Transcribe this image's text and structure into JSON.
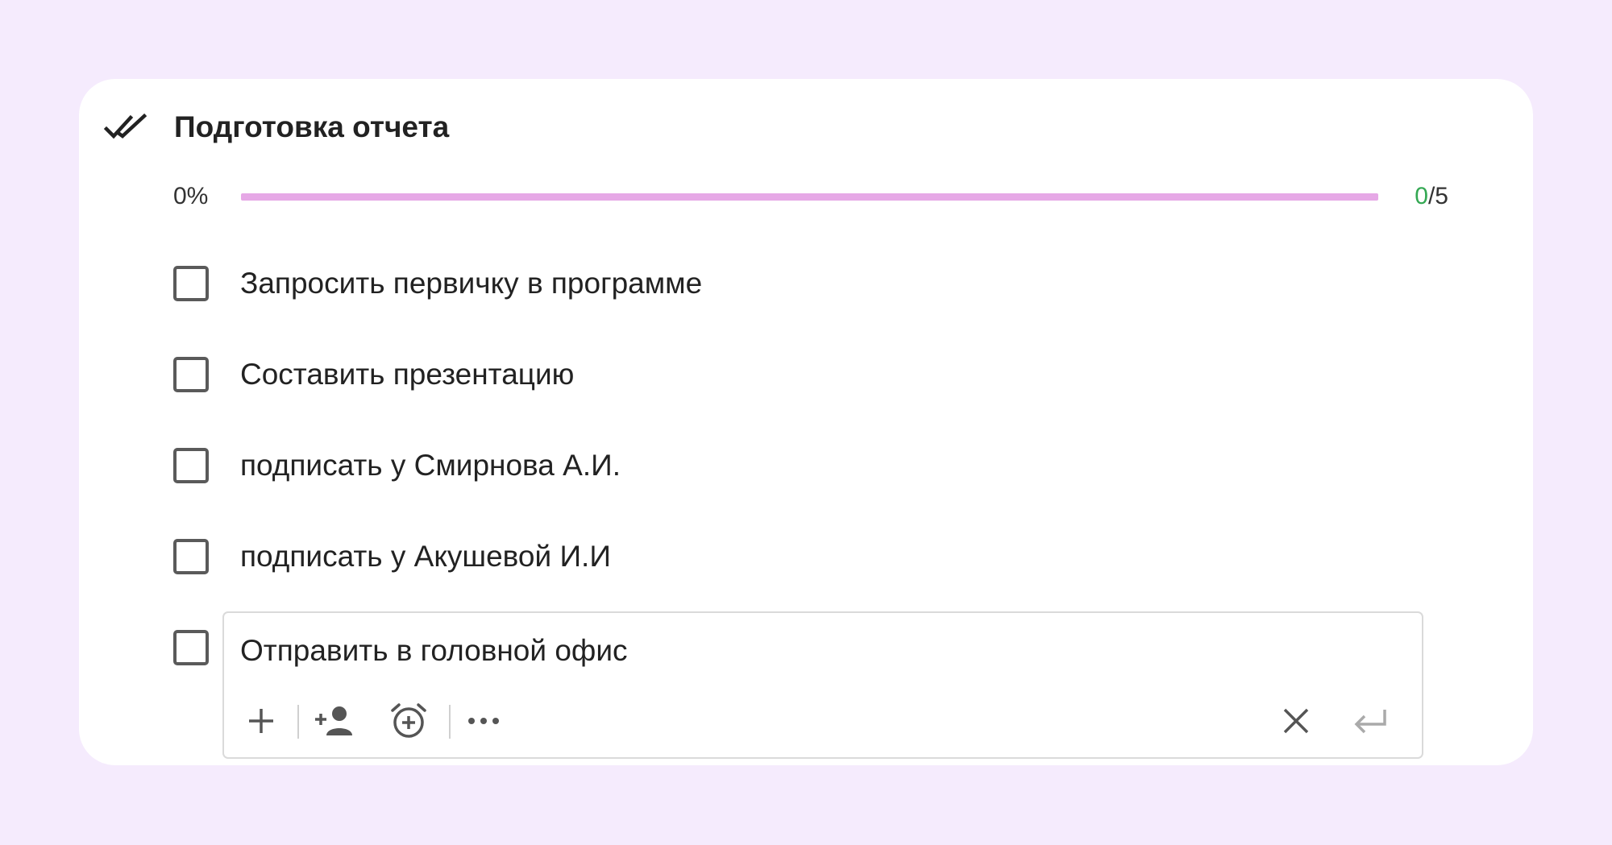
{
  "checklist": {
    "title": "Подготовка отчета",
    "header_icon": "double-check-icon",
    "progress": {
      "percent_label": "0%",
      "fraction": 0,
      "done": "0",
      "separator_total": "/5"
    },
    "tasks": [
      {
        "label": "Запросить первичку в программе",
        "checked": false
      },
      {
        "label": "Составить презентацию",
        "checked": false
      },
      {
        "label": "подписать у Смирнова А.И.",
        "checked": false
      },
      {
        "label": "подписать у Акушевой И.И",
        "checked": false
      }
    ],
    "editing_task": {
      "value": "Отправить в головной офис",
      "checked": false
    },
    "toolbar": {
      "icons": [
        "plus-icon",
        "add-person-icon",
        "alarm-add-icon",
        "more-horizontal-icon",
        "close-icon",
        "enter-icon"
      ]
    }
  },
  "colors": {
    "background": "#f5ebfd",
    "card": "#ffffff",
    "progress_track": "#e6a8e6",
    "done_count": "#34a853"
  }
}
